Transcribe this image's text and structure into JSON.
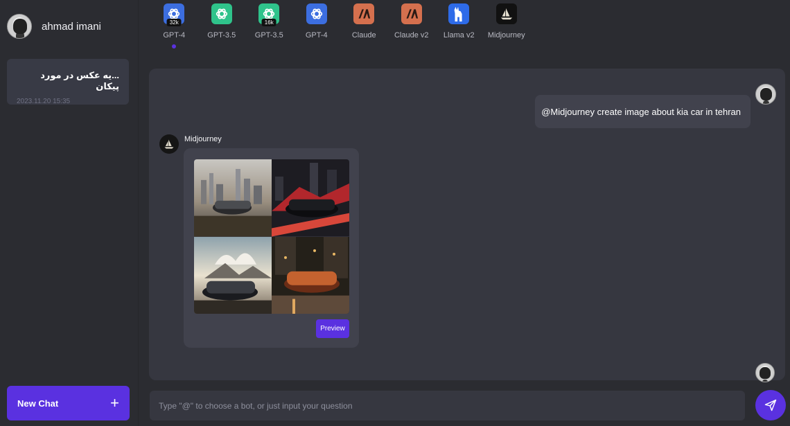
{
  "user": {
    "name": "ahmad imani"
  },
  "sidebar": {
    "chats": [
      {
        "title": "...یه عکس در مورد پیکان",
        "time": "2023.11.20 15:35"
      }
    ],
    "new_chat_label": "New Chat",
    "new_chat_icon": "plus-icon"
  },
  "bots": [
    {
      "label": "GPT-4",
      "badge": "32k",
      "icon": "openai-icon",
      "color": "#3c6ee0",
      "selected": true
    },
    {
      "label": "GPT-3.5",
      "badge": "",
      "icon": "openai-icon",
      "color": "#2fc38b"
    },
    {
      "label": "GPT-3.5",
      "badge": "16k",
      "icon": "openai-icon",
      "color": "#2fc38b"
    },
    {
      "label": "GPT-4",
      "badge": "",
      "icon": "openai-icon",
      "color": "#3c6ee0"
    },
    {
      "label": "Claude",
      "badge": "",
      "icon": "anthropic-icon",
      "color": "#d5704e"
    },
    {
      "label": "Claude v2",
      "badge": "",
      "icon": "anthropic-icon",
      "color": "#d5704e"
    },
    {
      "label": "Llama v2",
      "badge": "",
      "icon": "llama-icon",
      "color": "#2e6be8"
    },
    {
      "label": "Midjourney",
      "badge": "",
      "icon": "midjourney-icon",
      "color": "#111111"
    }
  ],
  "conversation": {
    "user_message": "@Midjourney  create image about kia car in tehran",
    "bot_name": "Midjourney",
    "preview_label": "Preview"
  },
  "input": {
    "placeholder": "Type \"@\" to choose a bot, or just input your question"
  },
  "colors": {
    "accent": "#5a31e0",
    "panel": "#363740",
    "bubble": "#41424d",
    "background": "#2b2c31"
  }
}
